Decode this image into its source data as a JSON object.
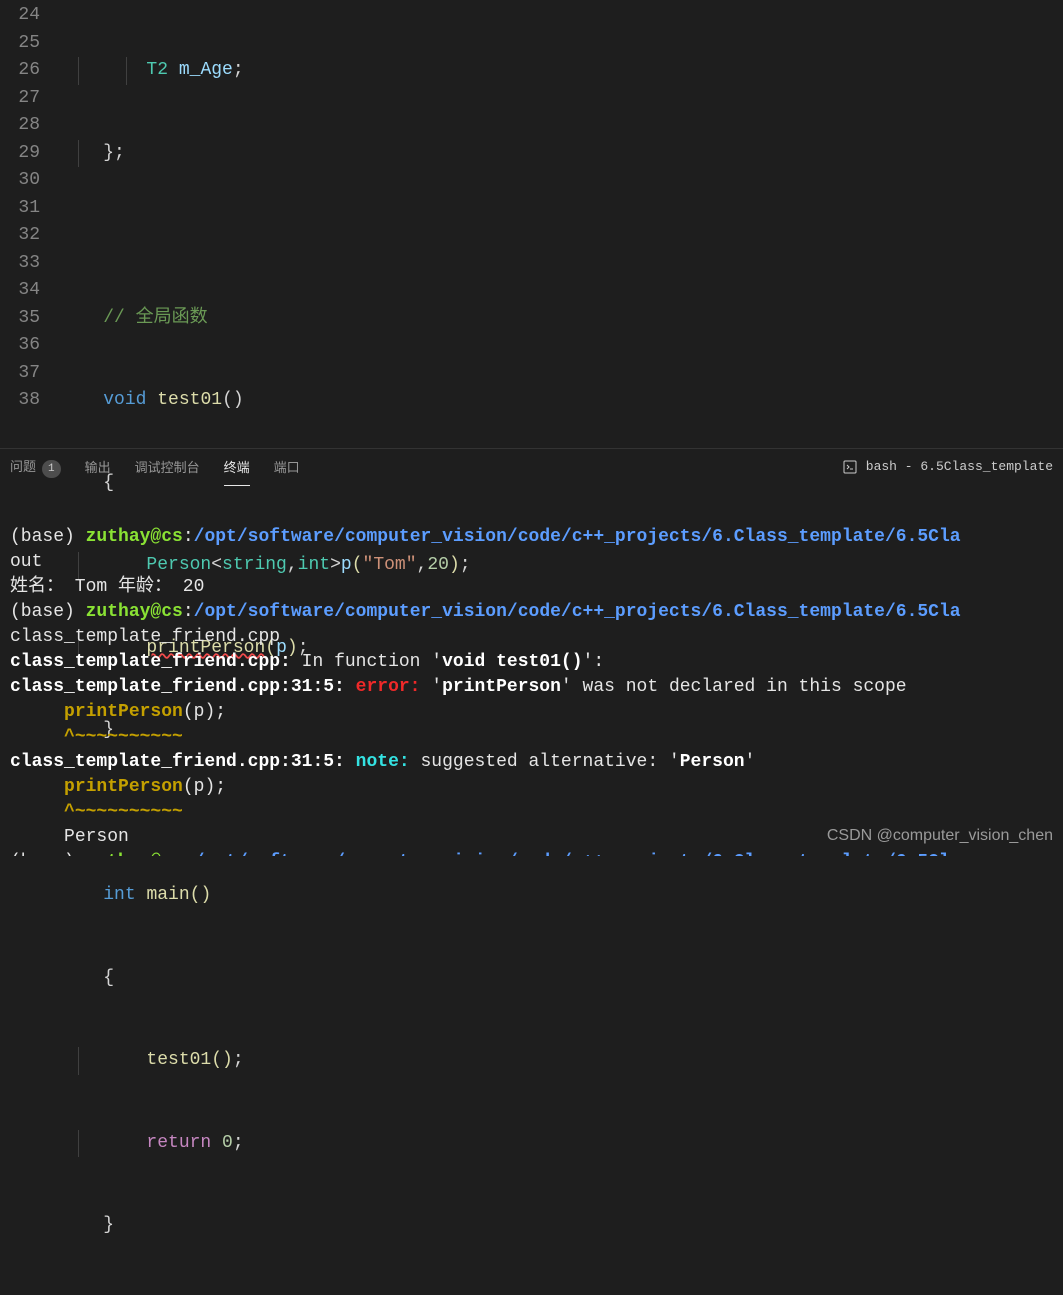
{
  "editor": {
    "lines": {
      "start": 24,
      "end": 38
    },
    "code": {
      "l24_type": "T2",
      "l24_var": "m_Age",
      "l27_comment": "// 全局函数",
      "l28_void": "void",
      "l28_fn": "test01",
      "l30_class": "Person",
      "l30_str_t": "string",
      "l30_int_t": "int",
      "l30_p": "p",
      "l30_tom": "\"Tom\"",
      "l30_20": "20",
      "l31_fn": "printPerson",
      "l31_arg": "p",
      "l34_int": "int",
      "l34_main": "main",
      "l36_call": "test01",
      "l37_ret": "return",
      "l37_zero": "0"
    }
  },
  "panel": {
    "tabs": {
      "problems": "问题",
      "problems_count": "1",
      "output": "输出",
      "debug": "调试控制台",
      "terminal": "终端",
      "ports": "端口"
    },
    "shell_label": "bash - 6.5Class_template"
  },
  "terminal": {
    "base": "(base) ",
    "userhost": "zuthay@cs",
    "colon": ":",
    "path": "/opt/software/computer_vision/code/c++_projects/6.Class_template/6.5Cla",
    "out": "out",
    "run_output": "姓名： Tom 年龄： 20",
    "compile_file": "class_template_friend.cpp",
    "err_file": "class_template_friend.cpp:",
    "in_func": " In function '",
    "func_sig": "void test01()",
    "err_loc": "class_template_friend.cpp:31:5:",
    "error_label": "error:",
    "err_msg1": " '",
    "err_sym": "printPerson",
    "err_msg2": "' was not declared in this scope",
    "err_code": "printPerson",
    "err_code_args": "(p);",
    "err_caret": "^~~~~~~~~~~",
    "note_label": "note:",
    "note_msg": " suggested alternative: '",
    "note_sym": "Person",
    "note_end": "'",
    "alt": "Person"
  },
  "watermark": "CSDN @computer_vision_chen"
}
